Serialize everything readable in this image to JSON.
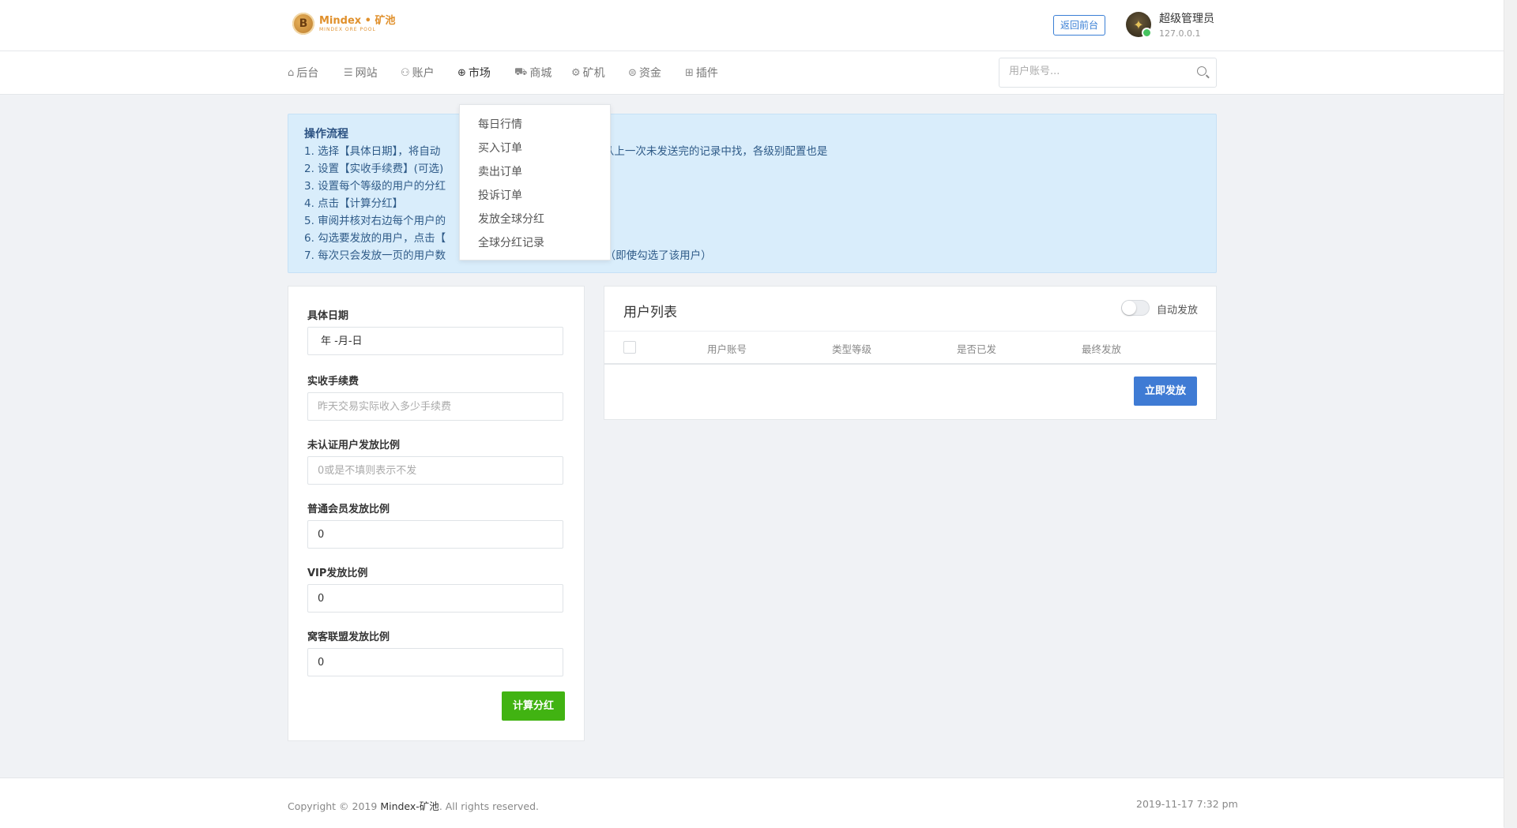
{
  "header": {
    "logo": {
      "title": "Mindex • 矿池",
      "subtitle": "MINDEX ORE POOL",
      "coin_letter": "B"
    },
    "back_button": "返回前台",
    "user": {
      "name": "超级管理员",
      "ip": "127.0.0.1",
      "online_color": "#46c35f"
    }
  },
  "nav": {
    "items": [
      {
        "label": "后台",
        "icon": "home-icon",
        "glyph": "⌂"
      },
      {
        "label": "网站",
        "icon": "list-icon",
        "glyph": "☰"
      },
      {
        "label": "账户",
        "icon": "users-icon",
        "glyph": "⚇"
      },
      {
        "label": "市场",
        "icon": "globe-icon",
        "glyph": "⊕"
      },
      {
        "label": "商城",
        "icon": "cart-icon",
        "glyph": "⛟"
      },
      {
        "label": "矿机",
        "icon": "gear-icon",
        "glyph": "⚙"
      },
      {
        "label": "资金",
        "icon": "coin-icon",
        "glyph": "⊜"
      },
      {
        "label": "插件",
        "icon": "grid-icon",
        "glyph": "⊞"
      }
    ],
    "active": "市场",
    "search_placeholder": "用户账号..."
  },
  "market_dropdown": [
    "每日行情",
    "买入订单",
    "卖出订单",
    "投诉订单",
    "发放全球分红",
    "全球分红记录"
  ],
  "notice": {
    "title": "操作流程",
    "lines": [
      "1. 选择【具体日期】，将自动",
      "2. 设置【实收手续费】(可选)",
      "3. 设置每个等级的用户的分红",
      "4. 点击【计算分红】",
      "5. 审阅并核对右边每个用户的",
      "6. 勾选要发放的用户，点击【",
      "7. 每次只会发放一页的用户数"
    ],
    "line1_tail": "先从上一次未发送完的记录中找，各级别配置也是",
    "line7_tail": "放（即使勾选了该用户）"
  },
  "form": {
    "date_label": "具体日期",
    "date_value": "年 -月-日",
    "fee_label": "实收手续费",
    "fee_placeholder": "昨天交易实际收入多少手续费",
    "unverified_label": "未认证用户发放比例",
    "unverified_placeholder": "0或是不填则表示不发",
    "normal_label": "普通会员发放比例",
    "normal_value": "0",
    "vip_label": "VIP发放比例",
    "vip_value": "0",
    "alliance_label": "窝客联盟发放比例",
    "alliance_value": "0",
    "calc_button": "计算分红",
    "calc_color": "#41b312"
  },
  "user_list": {
    "title": "用户列表",
    "auto_label": "自动发放",
    "auto_enabled": false,
    "columns": [
      "用户账号",
      "类型等级",
      "是否已发",
      "最终发放"
    ],
    "send_button": "立即发放",
    "send_color": "#3f7bd4"
  },
  "footer": {
    "copyright_prefix": "Copyright © 2019 ",
    "brand": "Mindex-矿池",
    "copyright_suffix": ". All rights reserved.",
    "date": "2019-11-17 7:32 pm"
  }
}
